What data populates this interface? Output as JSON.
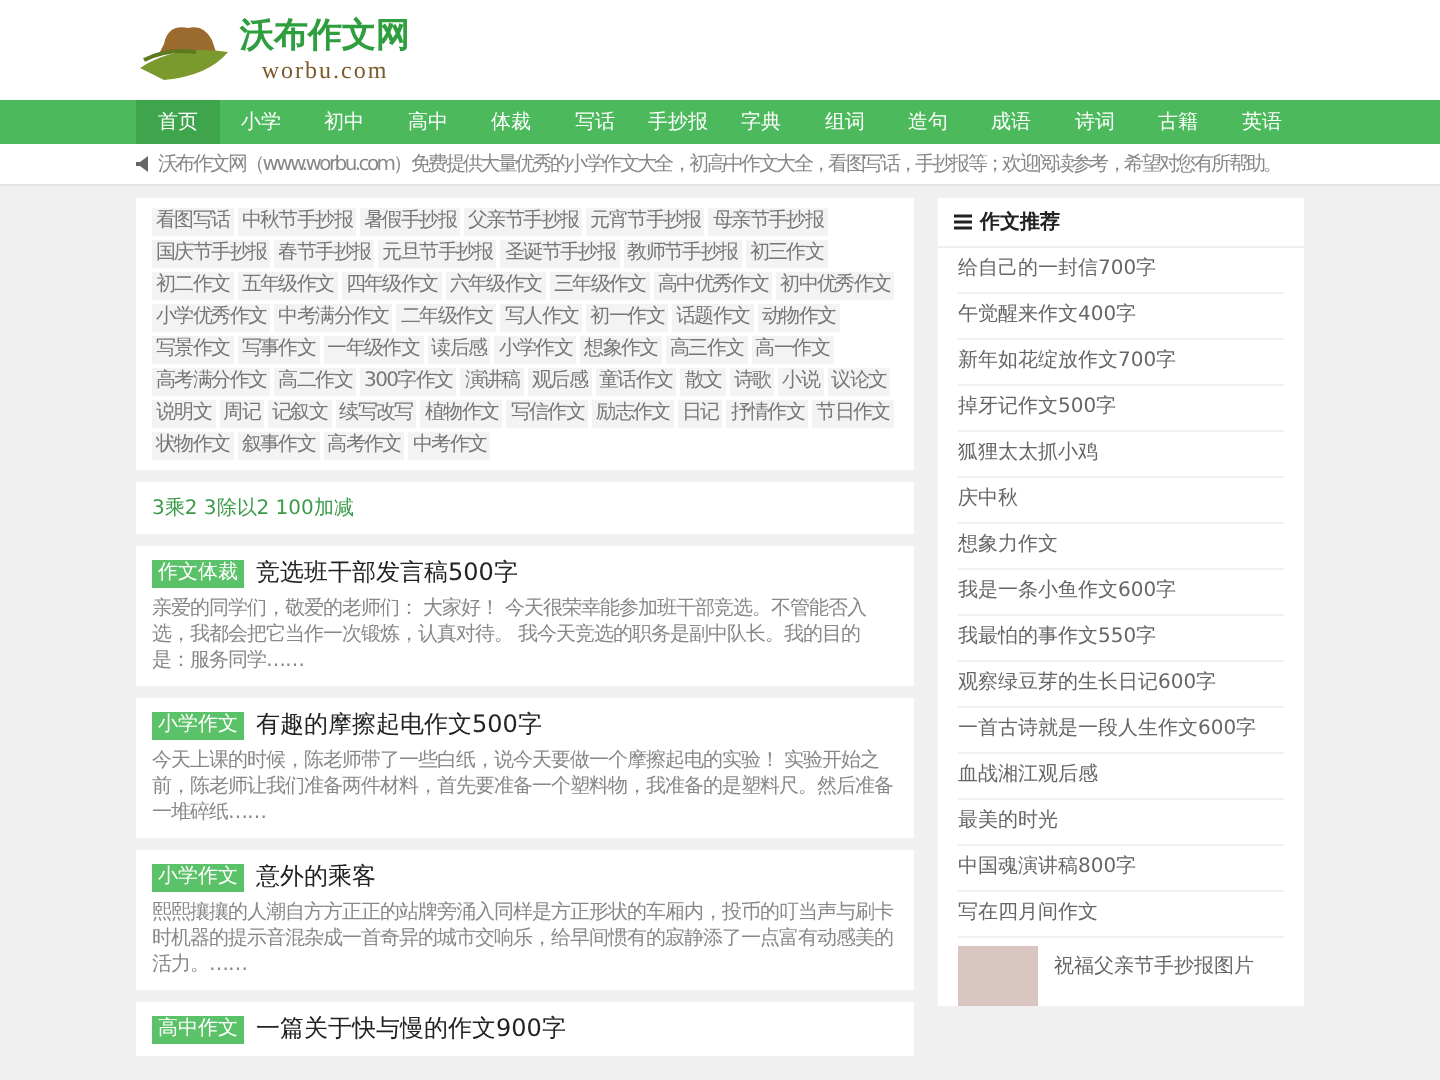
{
  "site": {
    "name": "沃布作文网",
    "domain": "worbu.com"
  },
  "nav": [
    {
      "label": "首页",
      "selected": true
    },
    {
      "label": "小学",
      "selected": false
    },
    {
      "label": "初中",
      "selected": false
    },
    {
      "label": "高中",
      "selected": false
    },
    {
      "label": "体裁",
      "selected": false
    },
    {
      "label": "写话",
      "selected": false
    },
    {
      "label": "手抄报",
      "selected": false
    },
    {
      "label": "字典",
      "selected": false
    },
    {
      "label": "组词",
      "selected": false
    },
    {
      "label": "造句",
      "selected": false
    },
    {
      "label": "成语",
      "selected": false
    },
    {
      "label": "诗词",
      "selected": false
    },
    {
      "label": "古籍",
      "selected": false
    },
    {
      "label": "英语",
      "selected": false
    }
  ],
  "notice": "沃布作文网（www.worbu.com）免费提供大量优秀的小学作文大全，初高中作文大全，看图写话，手抄报等；欢迎阅读参考，希望对您有所帮助。",
  "tags": [
    "看图写话",
    "中秋节手抄报",
    "暑假手抄报",
    "父亲节手抄报",
    "元宵节手抄报",
    "母亲节手抄报",
    "国庆节手抄报",
    "春节手抄报",
    "元旦节手抄报",
    "圣诞节手抄报",
    "教师节手抄报",
    "初三作文",
    "初二作文",
    "五年级作文",
    "四年级作文",
    "六年级作文",
    "三年级作文",
    "高中优秀作文",
    "初中优秀作文",
    "小学优秀作文",
    "中考满分作文",
    "二年级作文",
    "写人作文",
    "初一作文",
    "话题作文",
    "动物作文",
    "写景作文",
    "写事作文",
    "一年级作文",
    "读后感",
    "小学作文",
    "想象作文",
    "高三作文",
    "高一作文",
    "高考满分作文",
    "高二作文",
    "300字作文",
    "演讲稿",
    "观后感",
    "童话作文",
    "散文",
    "诗歌",
    "小说",
    "议论文",
    "说明文",
    "周记",
    "记叙文",
    "续写改写",
    "植物作文",
    "写信作文",
    "励志作文",
    "日记",
    "抒情作文",
    "节日作文",
    "状物作文",
    "叙事作文",
    "高考作文",
    "中考作文"
  ],
  "link_line": "3乘2 3除以2 100加减",
  "articles": [
    {
      "tag": "作文体裁",
      "title": "竞选班干部发言稿500字",
      "excerpt": "亲爱的同学们，敬爱的老师们： 大家好！ 今天很荣幸能参加班干部竞选。不管能否入选，我都会把它当作一次锻炼，认真对待。 我今天竞选的职务是副中队长。我的目的是：服务同学……"
    },
    {
      "tag": "小学作文",
      "title": "有趣的摩擦起电作文500字",
      "excerpt": "今天上课的时候，陈老师带了一些白纸，说今天要做一个摩擦起电的实验！ 实验开始之前，陈老师让我们准备两件材料，首先要准备一个塑料物，我准备的是塑料尺。然后准备一堆碎纸……"
    },
    {
      "tag": "小学作文",
      "title": "意外的乘客",
      "excerpt": "熙熙攘攘的人潮自方方正正的站牌旁涌入同样是方正形状的车厢内，投币的叮当声与刷卡时机器的提示音混杂成一首奇异的城市交响乐，给早间惯有的寂静添了一点富有动感美的活力。……"
    },
    {
      "tag": "高中作文",
      "title": "一篇关于快与慢的作文900字"
    }
  ],
  "sidebar": {
    "title": "作文推荐",
    "items": [
      "给自己的一封信700字",
      "午觉醒来作文400字",
      "新年如花绽放作文700字",
      "掉牙记作文500字",
      "狐狸太太抓小鸡",
      "庆中秋",
      "想象力作文",
      "我是一条小鱼作文600字",
      "我最怕的事作文550字",
      "观察绿豆芽的生长日记600字",
      "一首古诗就是一段人生作文600字",
      "血战湘江观后感",
      "最美的时光",
      "中国魂演讲稿800字",
      "写在四月间作文"
    ],
    "image_item": "祝福父亲节手抄报图片"
  }
}
